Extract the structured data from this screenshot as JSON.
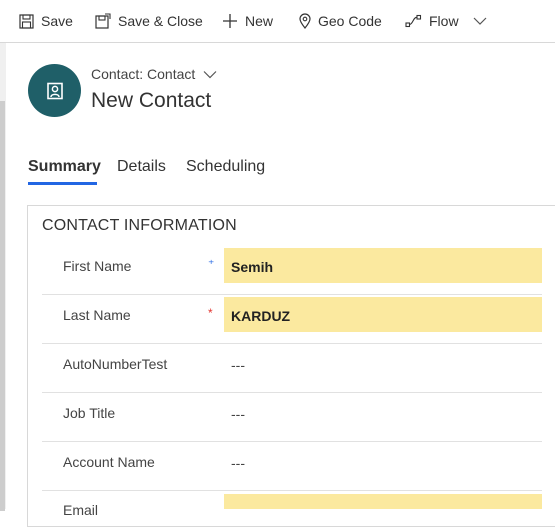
{
  "toolbar": {
    "save": "Save",
    "save_close": "Save & Close",
    "new": "New",
    "geo_code": "Geo Code",
    "flow": "Flow"
  },
  "header": {
    "entity_label": "Contact: Contact",
    "record_title": "New Contact"
  },
  "tabs": [
    {
      "label": "Summary",
      "active": true
    },
    {
      "label": "Details",
      "active": false
    },
    {
      "label": "Scheduling",
      "active": false
    }
  ],
  "section": {
    "title": "CONTACT INFORMATION",
    "fields": [
      {
        "label": "First Name",
        "value": "Semih",
        "required": "recommended"
      },
      {
        "label": "Last Name",
        "value": "KARDUZ",
        "required": "required"
      },
      {
        "label": "AutoNumberTest",
        "value": "---"
      },
      {
        "label": "Job Title",
        "value": "---"
      },
      {
        "label": "Account Name",
        "value": "---"
      },
      {
        "label": "Email",
        "value": ""
      }
    ]
  },
  "colors": {
    "accent": "#2266e3",
    "avatar_bg": "#1f5f68",
    "field_highlight": "#fbe99f",
    "required_red": "#e3342f"
  }
}
